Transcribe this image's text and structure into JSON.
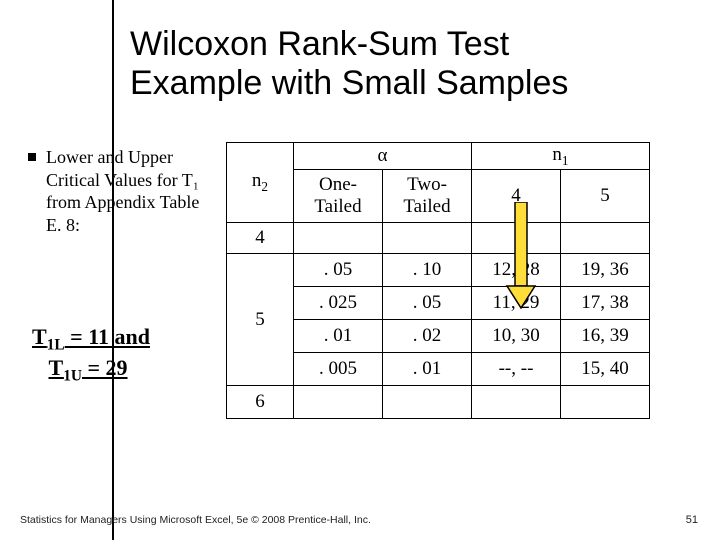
{
  "title_line1": "Wilcoxon Rank-Sum Test",
  "title_line2": "Example with Small Samples",
  "bullet_text": "Lower and Upper Critical Values for T₁ from Appendix Table E. 8:",
  "crit_line1_a": "T",
  "crit_line1_sub1": "1L",
  "crit_line1_mid": " = 11  and",
  "crit_line2_a": "T",
  "crit_line2_sub1": "1U",
  "crit_line2_mid": " = 29",
  "alpha": "α",
  "n1": "n",
  "n1_sub": "1",
  "n2": "n",
  "n2_sub": "2",
  "one_tail": "One-\nTailed",
  "two_tail": "Two-\nTailed",
  "h4": "4",
  "h5": "5",
  "left4": "4",
  "left5": "5",
  "left6": "6",
  "r1c1": ". 05",
  "r1c2": ". 10",
  "r1c3": "12, 28",
  "r1c4": "19, 36",
  "r2c1": ". 025",
  "r2c2": ". 05",
  "r2c3": "11, 29",
  "r2c4": "17, 38",
  "r3c1": ". 01",
  "r3c2": ". 02",
  "r3c3": "10, 30",
  "r3c4": "16, 39",
  "r4c1": ". 005",
  "r4c2": ". 01",
  "r4c3": "--, --",
  "r4c4": "15, 40",
  "footer": "Statistics for Managers Using Microsoft Excel, 5e © 2008 Prentice-Hall, Inc.",
  "page": "51",
  "chart_data": {
    "type": "table",
    "title": "Wilcoxon Rank-Sum Test critical values (Appendix Table E.8 excerpt)",
    "row_var": "n2",
    "col_var": "n1",
    "n1_levels": [
      4,
      5
    ],
    "rows": [
      {
        "n2": 5,
        "alpha_one": 0.05,
        "alpha_two": 0.1,
        "n1_4": [
          12,
          28
        ],
        "n1_5": [
          19,
          36
        ]
      },
      {
        "n2": 5,
        "alpha_one": 0.025,
        "alpha_two": 0.05,
        "n1_4": [
          11,
          29
        ],
        "n1_5": [
          17,
          38
        ]
      },
      {
        "n2": 5,
        "alpha_one": 0.01,
        "alpha_two": 0.02,
        "n1_4": [
          10,
          30
        ],
        "n1_5": [
          16,
          39
        ]
      },
      {
        "n2": 5,
        "alpha_one": 0.005,
        "alpha_two": 0.01,
        "n1_4": null,
        "n1_5": [
          15,
          40
        ]
      }
    ],
    "highlighted": {
      "n2": 5,
      "alpha_two": 0.05,
      "n1": 4,
      "value": [
        11,
        29
      ]
    }
  }
}
